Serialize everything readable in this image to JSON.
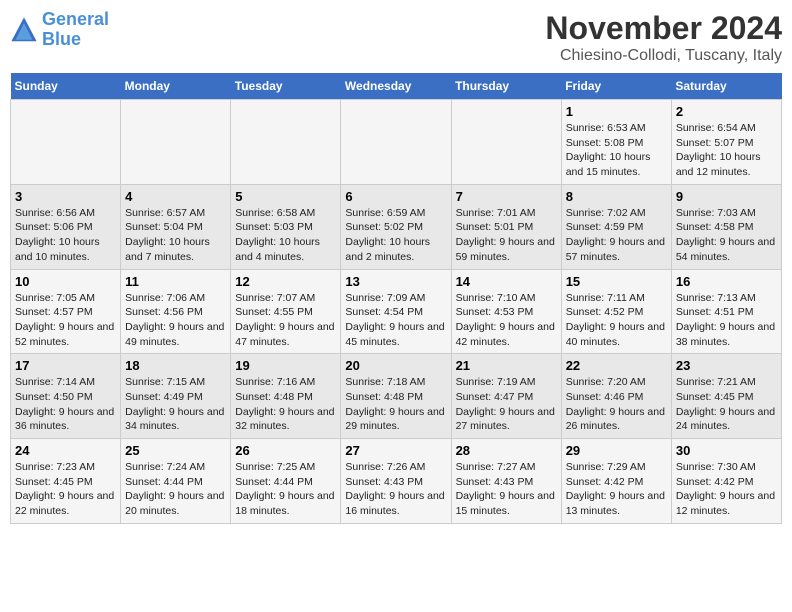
{
  "header": {
    "logo_line1": "General",
    "logo_line2": "Blue",
    "main_title": "November 2024",
    "sub_title": "Chiesino-Collodi, Tuscany, Italy"
  },
  "days_of_week": [
    "Sunday",
    "Monday",
    "Tuesday",
    "Wednesday",
    "Thursday",
    "Friday",
    "Saturday"
  ],
  "weeks": [
    [
      {
        "day": "",
        "info": ""
      },
      {
        "day": "",
        "info": ""
      },
      {
        "day": "",
        "info": ""
      },
      {
        "day": "",
        "info": ""
      },
      {
        "day": "",
        "info": ""
      },
      {
        "day": "1",
        "info": "Sunrise: 6:53 AM\nSunset: 5:08 PM\nDaylight: 10 hours and 15 minutes."
      },
      {
        "day": "2",
        "info": "Sunrise: 6:54 AM\nSunset: 5:07 PM\nDaylight: 10 hours and 12 minutes."
      }
    ],
    [
      {
        "day": "3",
        "info": "Sunrise: 6:56 AM\nSunset: 5:06 PM\nDaylight: 10 hours and 10 minutes."
      },
      {
        "day": "4",
        "info": "Sunrise: 6:57 AM\nSunset: 5:04 PM\nDaylight: 10 hours and 7 minutes."
      },
      {
        "day": "5",
        "info": "Sunrise: 6:58 AM\nSunset: 5:03 PM\nDaylight: 10 hours and 4 minutes."
      },
      {
        "day": "6",
        "info": "Sunrise: 6:59 AM\nSunset: 5:02 PM\nDaylight: 10 hours and 2 minutes."
      },
      {
        "day": "7",
        "info": "Sunrise: 7:01 AM\nSunset: 5:01 PM\nDaylight: 9 hours and 59 minutes."
      },
      {
        "day": "8",
        "info": "Sunrise: 7:02 AM\nSunset: 4:59 PM\nDaylight: 9 hours and 57 minutes."
      },
      {
        "day": "9",
        "info": "Sunrise: 7:03 AM\nSunset: 4:58 PM\nDaylight: 9 hours and 54 minutes."
      }
    ],
    [
      {
        "day": "10",
        "info": "Sunrise: 7:05 AM\nSunset: 4:57 PM\nDaylight: 9 hours and 52 minutes."
      },
      {
        "day": "11",
        "info": "Sunrise: 7:06 AM\nSunset: 4:56 PM\nDaylight: 9 hours and 49 minutes."
      },
      {
        "day": "12",
        "info": "Sunrise: 7:07 AM\nSunset: 4:55 PM\nDaylight: 9 hours and 47 minutes."
      },
      {
        "day": "13",
        "info": "Sunrise: 7:09 AM\nSunset: 4:54 PM\nDaylight: 9 hours and 45 minutes."
      },
      {
        "day": "14",
        "info": "Sunrise: 7:10 AM\nSunset: 4:53 PM\nDaylight: 9 hours and 42 minutes."
      },
      {
        "day": "15",
        "info": "Sunrise: 7:11 AM\nSunset: 4:52 PM\nDaylight: 9 hours and 40 minutes."
      },
      {
        "day": "16",
        "info": "Sunrise: 7:13 AM\nSunset: 4:51 PM\nDaylight: 9 hours and 38 minutes."
      }
    ],
    [
      {
        "day": "17",
        "info": "Sunrise: 7:14 AM\nSunset: 4:50 PM\nDaylight: 9 hours and 36 minutes."
      },
      {
        "day": "18",
        "info": "Sunrise: 7:15 AM\nSunset: 4:49 PM\nDaylight: 9 hours and 34 minutes."
      },
      {
        "day": "19",
        "info": "Sunrise: 7:16 AM\nSunset: 4:48 PM\nDaylight: 9 hours and 32 minutes."
      },
      {
        "day": "20",
        "info": "Sunrise: 7:18 AM\nSunset: 4:48 PM\nDaylight: 9 hours and 29 minutes."
      },
      {
        "day": "21",
        "info": "Sunrise: 7:19 AM\nSunset: 4:47 PM\nDaylight: 9 hours and 27 minutes."
      },
      {
        "day": "22",
        "info": "Sunrise: 7:20 AM\nSunset: 4:46 PM\nDaylight: 9 hours and 26 minutes."
      },
      {
        "day": "23",
        "info": "Sunrise: 7:21 AM\nSunset: 4:45 PM\nDaylight: 9 hours and 24 minutes."
      }
    ],
    [
      {
        "day": "24",
        "info": "Sunrise: 7:23 AM\nSunset: 4:45 PM\nDaylight: 9 hours and 22 minutes."
      },
      {
        "day": "25",
        "info": "Sunrise: 7:24 AM\nSunset: 4:44 PM\nDaylight: 9 hours and 20 minutes."
      },
      {
        "day": "26",
        "info": "Sunrise: 7:25 AM\nSunset: 4:44 PM\nDaylight: 9 hours and 18 minutes."
      },
      {
        "day": "27",
        "info": "Sunrise: 7:26 AM\nSunset: 4:43 PM\nDaylight: 9 hours and 16 minutes."
      },
      {
        "day": "28",
        "info": "Sunrise: 7:27 AM\nSunset: 4:43 PM\nDaylight: 9 hours and 15 minutes."
      },
      {
        "day": "29",
        "info": "Sunrise: 7:29 AM\nSunset: 4:42 PM\nDaylight: 9 hours and 13 minutes."
      },
      {
        "day": "30",
        "info": "Sunrise: 7:30 AM\nSunset: 4:42 PM\nDaylight: 9 hours and 12 minutes."
      }
    ]
  ]
}
